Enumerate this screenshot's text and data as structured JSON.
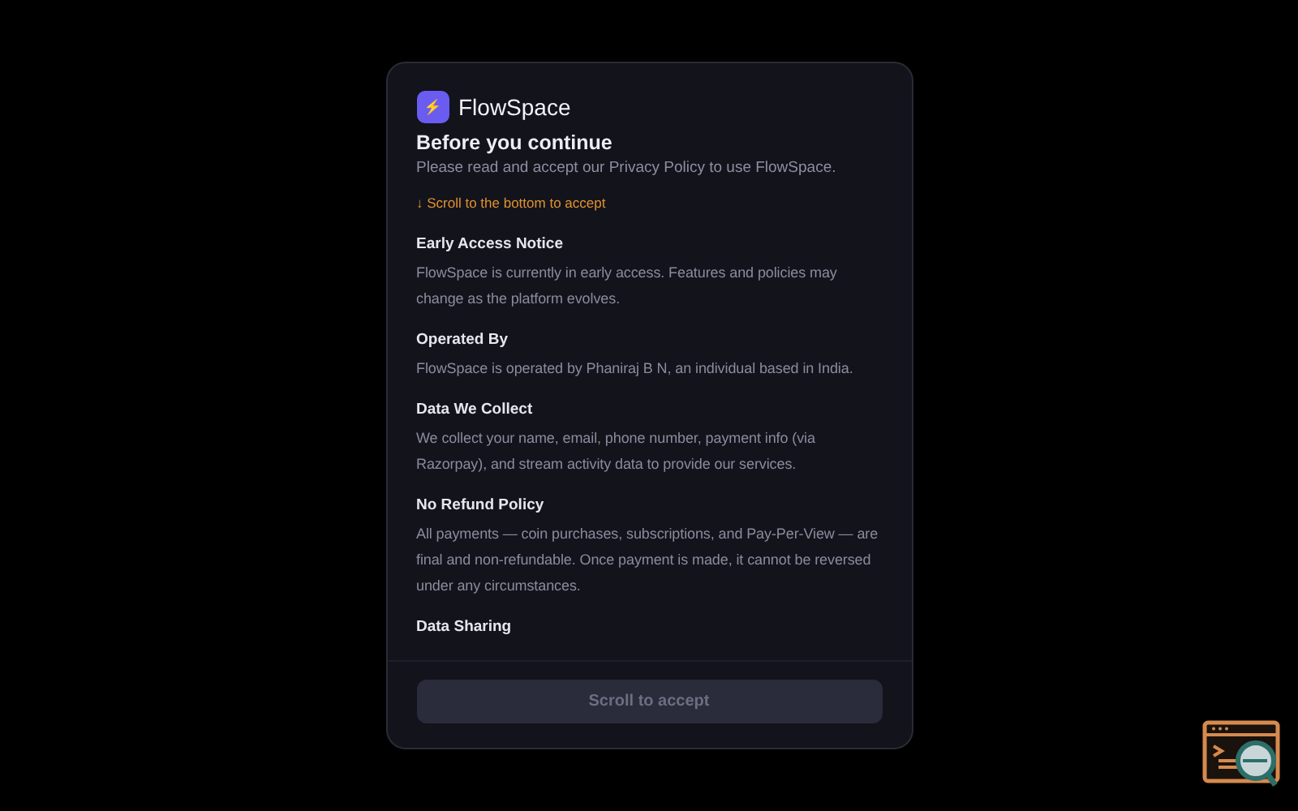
{
  "dialog": {
    "brand": "FlowSpace",
    "brand_icon": "⚡",
    "title": "Before you continue",
    "subtitle": "Please read and accept our Privacy Policy to use FlowSpace.",
    "scroll_hint": "↓ Scroll to the bottom to accept",
    "sections": [
      {
        "heading": "Early Access Notice",
        "body": "FlowSpace is currently in early access. Features and policies may change as the platform evolves."
      },
      {
        "heading": "Operated By",
        "body": "FlowSpace is operated by Phaniraj B N, an individual based in India."
      },
      {
        "heading": "Data We Collect",
        "body": "We collect your name, email, phone number, payment info (via Razorpay), and stream activity data to provide our services."
      },
      {
        "heading": "No Refund Policy",
        "body": "All payments — coin purchases, subscriptions, and Pay-Per-View — are final and non-refundable. Once payment is made, it cannot be reversed under any circumstances."
      },
      {
        "heading": "Data Sharing"
      }
    ],
    "accept_button": {
      "label": "Scroll to accept",
      "disabled": true
    }
  }
}
